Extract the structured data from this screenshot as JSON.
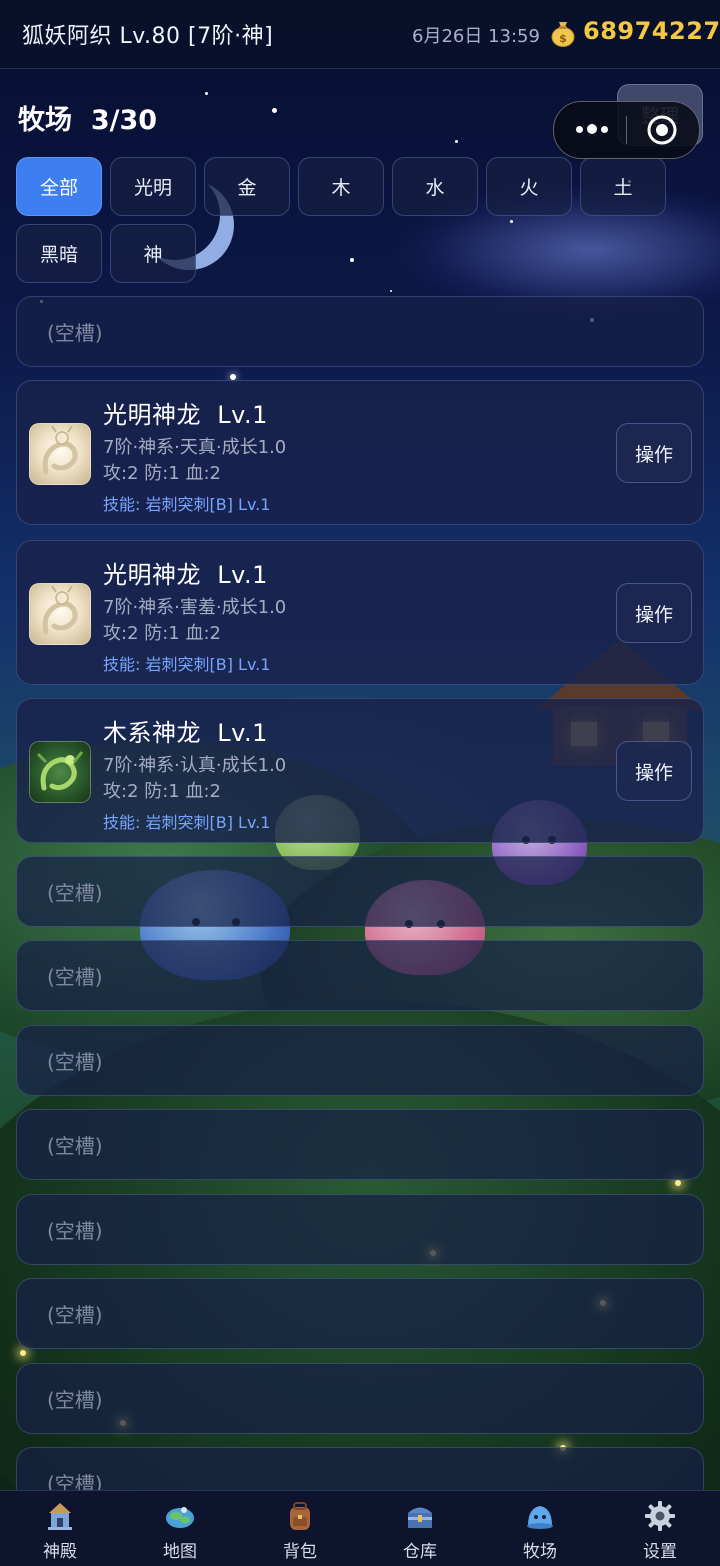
{
  "status_bar": {
    "player": "狐妖阿织 Lv.80 [7阶·神]",
    "datetime": "6月26日 13:59",
    "gold": "68974227",
    "coin_icon": "money-bag-icon"
  },
  "header": {
    "title": "牧场",
    "count": "3/30",
    "sort_label": "整理"
  },
  "filters": {
    "active": "全部",
    "items": [
      "全部",
      "光明",
      "金",
      "木",
      "水",
      "火",
      "土",
      "黑暗",
      "神"
    ]
  },
  "slots": [
    {
      "empty": true,
      "label": "(空槽)"
    },
    {
      "empty": false,
      "name": "光明神龙",
      "level": "Lv.1",
      "meta": "7阶·神系·天真·成长1.0",
      "stats": "攻:2 防:1 血:2",
      "skill": "技能: 岩刺突刺[B] Lv.1",
      "action": "操作",
      "avatar": "light-dragon-icon"
    },
    {
      "empty": false,
      "name": "光明神龙",
      "level": "Lv.1",
      "meta": "7阶·神系·害羞·成长1.0",
      "stats": "攻:2 防:1 血:2",
      "skill": "技能: 岩刺突刺[B] Lv.1",
      "action": "操作",
      "avatar": "light-dragon-icon"
    },
    {
      "empty": false,
      "name": "木系神龙",
      "level": "Lv.1",
      "meta": "7阶·神系·认真·成长1.0",
      "stats": "攻:2 防:1 血:2",
      "skill": "技能: 岩刺突刺[B] Lv.1",
      "action": "操作",
      "avatar": "wood-dragon-icon"
    },
    {
      "empty": true,
      "label": "(空槽)"
    },
    {
      "empty": true,
      "label": "(空槽)"
    },
    {
      "empty": true,
      "label": "(空槽)"
    },
    {
      "empty": true,
      "label": "(空槽)"
    },
    {
      "empty": true,
      "label": "(空槽)"
    },
    {
      "empty": true,
      "label": "(空槽)"
    },
    {
      "empty": true,
      "label": "(空槽)"
    },
    {
      "empty": true,
      "label": "(空槽)"
    }
  ],
  "bottom_nav": [
    {
      "label": "神殿",
      "icon": "temple-icon"
    },
    {
      "label": "地图",
      "icon": "map-icon"
    },
    {
      "label": "背包",
      "icon": "backpack-icon"
    },
    {
      "label": "仓库",
      "icon": "chest-icon"
    },
    {
      "label": "牧场",
      "icon": "slime-icon"
    },
    {
      "label": "设置",
      "icon": "gear-icon"
    }
  ],
  "colors": {
    "accent": "#3d7ff0",
    "gold": "#f5c842",
    "skill": "#78a4ff"
  }
}
